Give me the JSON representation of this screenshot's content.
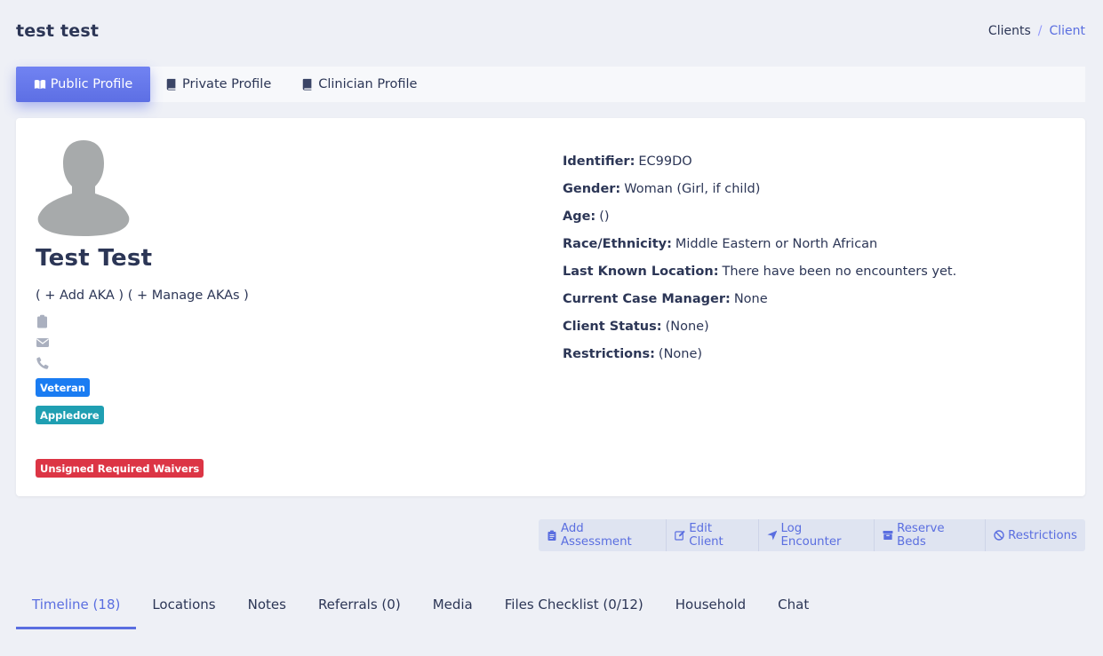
{
  "page": {
    "title": "test test"
  },
  "breadcrumb": {
    "items": [
      "Clients",
      "Client"
    ],
    "separator": "/"
  },
  "profile_tabs": [
    {
      "label": "Public Profile",
      "icon": "book-open-icon",
      "active": true
    },
    {
      "label": "Private Profile",
      "icon": "book-icon",
      "active": false
    },
    {
      "label": "Clinician Profile",
      "icon": "book-icon",
      "active": false
    }
  ],
  "client": {
    "name": "Test Test",
    "aka_add": "( + Add AKA )",
    "aka_manage": "( + Manage AKAs )",
    "badges": {
      "veteran": "Veteran",
      "appledore": "Appledore",
      "waivers": "Unsigned Required Waivers"
    }
  },
  "details": [
    {
      "label": "Identifier:",
      "value": "EC99DO"
    },
    {
      "label": "Gender:",
      "value": "Woman (Girl, if child)"
    },
    {
      "label": "Age:",
      "value": "()"
    },
    {
      "label": "Race/Ethnicity:",
      "value": "Middle Eastern or North African"
    },
    {
      "label": "Last Known Location:",
      "value": "There have been no encounters yet."
    },
    {
      "label": "Current Case Manager:",
      "value": "None"
    },
    {
      "label": "Client Status:",
      "value": "(None)"
    },
    {
      "label": "Restrictions:",
      "value": "(None)"
    }
  ],
  "actions": [
    {
      "label": "Add Assessment",
      "icon": "clipboard-icon"
    },
    {
      "label": "Edit Client",
      "icon": "edit-icon"
    },
    {
      "label": "Log Encounter",
      "icon": "location-arrow-icon"
    },
    {
      "label": "Reserve Beds",
      "icon": "archive-icon"
    },
    {
      "label": "Restrictions",
      "icon": "ban-icon"
    }
  ],
  "bottom_tabs": [
    {
      "label": "Timeline (18)",
      "active": true
    },
    {
      "label": "Locations",
      "active": false
    },
    {
      "label": "Notes",
      "active": false
    },
    {
      "label": "Referrals (0)",
      "active": false
    },
    {
      "label": "Media",
      "active": false
    },
    {
      "label": "Files Checklist (0/12)",
      "active": false
    },
    {
      "label": "Household",
      "active": false
    },
    {
      "label": "Chat",
      "active": false
    }
  ],
  "colors": {
    "accent": "#5a6ee0",
    "veteran": "#1a7cf2",
    "appledore": "#1f9fb2",
    "danger": "#dc3545",
    "text": "#2c3656"
  }
}
